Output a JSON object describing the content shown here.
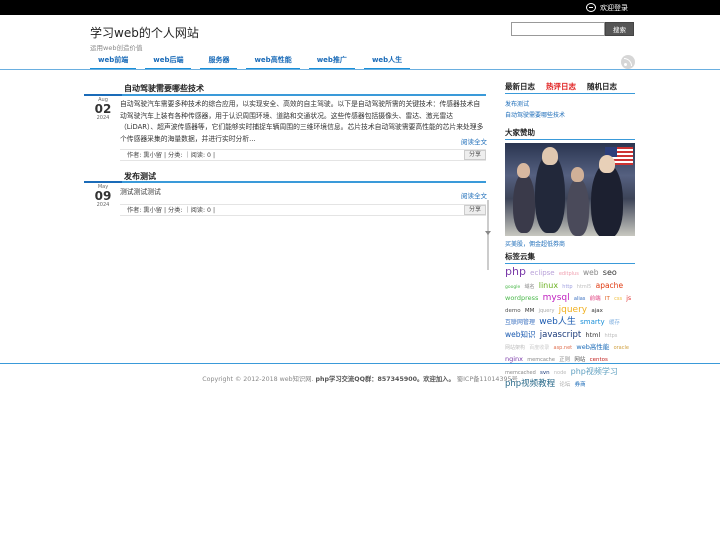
{
  "topbar": {
    "login_label": "欢迎登录"
  },
  "header": {
    "site_title": "学习web的个人网站",
    "site_subtitle": "运用web创造价值",
    "search_placeholder": "",
    "search_button": "搜索"
  },
  "nav": {
    "items": [
      {
        "label": "web前端"
      },
      {
        "label": "web后端"
      },
      {
        "label": "服务器"
      },
      {
        "label": "web高性能"
      },
      {
        "label": "web推广"
      },
      {
        "label": "web人生"
      }
    ]
  },
  "posts": [
    {
      "title": "自动驾驶需要哪些技术",
      "month": "Aug",
      "day": "02",
      "year": "2024",
      "excerpt": "自动驾驶汽车需要多种技术的综合应用，以实现安全、高效的自主驾驶。以下是自动驾驶所需的关键技术：传感器技术自动驾驶汽车上装有各种传感器，用于认识周围环境、道路和交通状况。这些传感器包括摄像头、雷达、激光雷达（LiDAR）、超声波传感器等，它们能够实时捕捉车辆周围的三维环境信息。芯片技术自动驾驶需要高性能的芯片来处理多个传感器采集的海量数据，并进行实时分析...",
      "read_more": "阅读全文",
      "meta": "作者: 熏小留 | 分类: ｜阅读: 0 |",
      "share": "分享"
    },
    {
      "title": "发布测试",
      "month": "May",
      "day": "09",
      "year": "2024",
      "excerpt": "测试测试测试",
      "read_more": "阅读全文",
      "meta": "作者: 熏小留 | 分类: ｜阅读: 0 |",
      "share": "分享"
    }
  ],
  "sidebar": {
    "tabs": [
      {
        "label": "最新日志",
        "active": false
      },
      {
        "label": "热评日志",
        "active": true
      },
      {
        "label": "随机日志",
        "active": false
      }
    ],
    "latest_posts": [
      "发布测试",
      "自动驾驶需要哪些技术"
    ],
    "sponsor_heading": "大家赞助",
    "sponsor_caption": "买美股，佣金超低券商",
    "tags_heading": "标签云集",
    "tags": [
      {
        "label": "php",
        "color": "#7a3aa8",
        "size": 11
      },
      {
        "label": "eclipse",
        "color": "#b8a0d8",
        "size": 7
      },
      {
        "label": "editplus",
        "color": "#f0a0b0",
        "size": 5
      },
      {
        "label": "web",
        "color": "#888888",
        "size": 7.5
      },
      {
        "label": "seo",
        "color": "#333333",
        "size": 8
      },
      {
        "label": "google",
        "color": "#4ab84a",
        "size": 4.5
      },
      {
        "label": "域名",
        "color": "#888888",
        "size": 5
      },
      {
        "label": "linux",
        "color": "#6ab020",
        "size": 8
      },
      {
        "label": "http",
        "color": "#a0a0e0",
        "size": 5
      },
      {
        "label": "html5",
        "color": "#c0c0c0",
        "size": 5
      },
      {
        "label": "apache",
        "color": "#e03a10",
        "size": 7.5
      },
      {
        "label": "wordpress",
        "color": "#4ab84a",
        "size": 6.5
      },
      {
        "label": "mysql",
        "color": "#c020c0",
        "size": 9
      },
      {
        "label": "alias",
        "color": "#3a70c0",
        "size": 5
      },
      {
        "label": "前端",
        "color": "#e04080",
        "size": 5.5
      },
      {
        "label": "IT",
        "color": "#e06020",
        "size": 5.5
      },
      {
        "label": "css",
        "color": "#f0c040",
        "size": 5
      },
      {
        "label": "js",
        "color": "#e03030",
        "size": 6
      },
      {
        "label": "demo",
        "color": "#555555",
        "size": 5.5
      },
      {
        "label": "MM",
        "color": "#333333",
        "size": 5.5
      },
      {
        "label": "jquery",
        "color": "#aaaaaa",
        "size": 5
      },
      {
        "label": "jquery",
        "color": "#f0b020",
        "size": 9
      },
      {
        "label": "ajax",
        "color": "#333333",
        "size": 5.5
      },
      {
        "label": "互联网管理",
        "color": "#3a70c0",
        "size": 6
      },
      {
        "label": "web人生",
        "color": "#1a5ab0",
        "size": 9
      },
      {
        "label": "smarty",
        "color": "#1a8fd8",
        "size": 7
      },
      {
        "label": "缓存",
        "color": "#80b0e0",
        "size": 5.5
      },
      {
        "label": "web知识",
        "color": "#1a5ab0",
        "size": 7.5
      },
      {
        "label": "javascript",
        "color": "#1a3a7a",
        "size": 8.5
      },
      {
        "label": "html",
        "color": "#333333",
        "size": 6.5
      },
      {
        "label": "https",
        "color": "#bbbbbb",
        "size": 5
      },
      {
        "label": "网站架构",
        "color": "#bbbbbb",
        "size": 5
      },
      {
        "label": "百度收录",
        "color": "#cccccc",
        "size": 5
      },
      {
        "label": "asp.net",
        "color": "#e07050",
        "size": 5
      },
      {
        "label": "web高性能",
        "color": "#1a6bb8",
        "size": 6.5
      },
      {
        "label": "oracle",
        "color": "#d0a040",
        "size": 5
      },
      {
        "label": "nginx",
        "color": "#7a3aa8",
        "size": 6.5
      },
      {
        "label": "memcache",
        "color": "#888888",
        "size": 5
      },
      {
        "label": "正则",
        "color": "#888888",
        "size": 5.5
      },
      {
        "label": "网站",
        "color": "#555555",
        "size": 5.5
      },
      {
        "label": "centos",
        "color": "#c02020",
        "size": 5.5
      },
      {
        "label": "memcached",
        "color": "#888888",
        "size": 5
      },
      {
        "label": "svn",
        "color": "#1a3a7a",
        "size": 5.5
      },
      {
        "label": "node",
        "color": "#bbbbbb",
        "size": 5
      },
      {
        "label": "php视频学习",
        "color": "#60a0c0",
        "size": 8
      },
      {
        "label": "php视频教程",
        "color": "#2a6a8a",
        "size": 8.5
      },
      {
        "label": "论坛",
        "color": "#aaaaaa",
        "size": 5.5
      },
      {
        "label": "券商",
        "color": "#1a6bb8",
        "size": 5.5
      }
    ]
  },
  "footer": {
    "copyright": "Copyright © 2012-2018 web知识网.",
    "qq": "php学习交流QQ群：857345900。欢迎加入。",
    "icp": "蜀ICP备11014395号"
  }
}
